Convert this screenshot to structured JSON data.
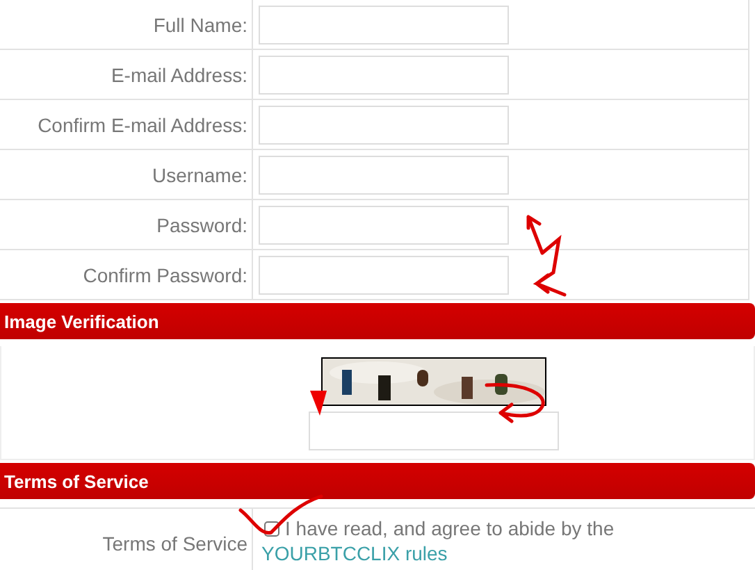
{
  "fields": [
    {
      "label": "Full Name:"
    },
    {
      "label": "E-mail Address:"
    },
    {
      "label": "Confirm E-mail Address:"
    },
    {
      "label": "Username:"
    },
    {
      "label": "Password:"
    },
    {
      "label": "Confirm Password:"
    }
  ],
  "image_verification": {
    "title": "Image Verification"
  },
  "terms": {
    "title": "Terms of Service",
    "label": "Terms of Service",
    "checked": false,
    "text": "I have read, and agree to abide by the",
    "link": "YOURBTCCLIX rules"
  }
}
